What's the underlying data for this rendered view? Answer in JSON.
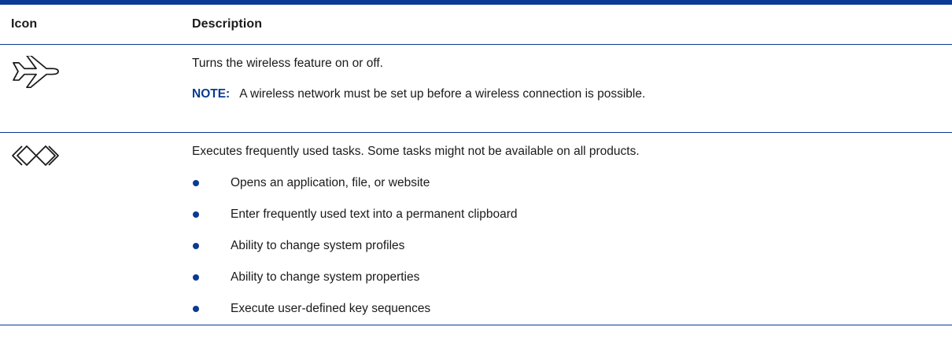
{
  "table": {
    "header": {
      "icon_col": "Icon",
      "desc_col": "Description"
    },
    "rows": [
      {
        "icon": "airplane-icon",
        "description": "Turns the wireless feature on or off.",
        "note_label": "NOTE:",
        "note_text": "A wireless network must be set up before a wireless connection is possible."
      },
      {
        "icon": "programmable-key-icon",
        "description": "Executes frequently used tasks. Some tasks might not be available on all products.",
        "bullets": [
          "Opens an application, file, or website",
          "Enter frequently used text into a permanent clipboard",
          "Ability to change system profiles",
          "Ability to change system properties",
          "Execute user-defined key sequences"
        ]
      }
    ]
  },
  "colors": {
    "rule": "#0a3a94",
    "note_label": "#0a3a94",
    "bullet": "#0a3a94"
  }
}
